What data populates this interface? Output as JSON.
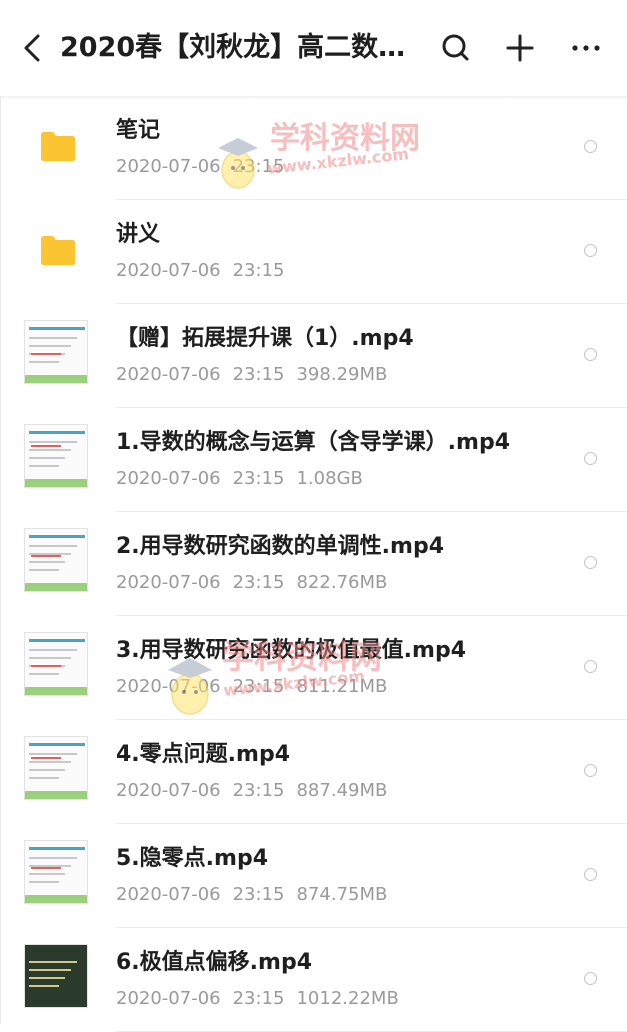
{
  "header": {
    "back_icon": "chevron-left-icon",
    "title": "2020春【刘秋龙】高二数学...",
    "search_icon": "search-icon",
    "add_icon": "plus-icon",
    "more_icon": "more-horizontal-icon"
  },
  "watermark": {
    "text_main": "学科资料网",
    "text_url": "www.xkzlw.com"
  },
  "colors": {
    "folder": "#fbc531",
    "title": "#1f1f1f",
    "meta": "#9a9a9a",
    "watermark": "#f06a6a"
  },
  "files": [
    {
      "type": "folder",
      "name": "笔记",
      "date": "2020-07-06",
      "time": "23:15",
      "size": ""
    },
    {
      "type": "folder",
      "name": "讲义",
      "date": "2020-07-06",
      "time": "23:15",
      "size": ""
    },
    {
      "type": "video",
      "name": "【赠】拓展提升课（1）.mp4",
      "date": "2020-07-06",
      "time": "23:15",
      "size": "398.29MB"
    },
    {
      "type": "video",
      "name": "1.导数的概念与运算（含导学课）.mp4",
      "date": "2020-07-06",
      "time": "23:15",
      "size": "1.08GB"
    },
    {
      "type": "video",
      "name": "2.用导数研究函数的单调性.mp4",
      "date": "2020-07-06",
      "time": "23:15",
      "size": "822.76MB"
    },
    {
      "type": "video",
      "name": "3.用导数研究函数的极值最值.mp4",
      "date": "2020-07-06",
      "time": "23:15",
      "size": "811.21MB"
    },
    {
      "type": "video",
      "name": "4.零点问题.mp4",
      "date": "2020-07-06",
      "time": "23:15",
      "size": "887.49MB"
    },
    {
      "type": "video",
      "name": "5.隐零点.mp4",
      "date": "2020-07-06",
      "time": "23:15",
      "size": "874.75MB"
    },
    {
      "type": "video-dark",
      "name": "6.极值点偏移.mp4",
      "date": "2020-07-06",
      "time": "23:15",
      "size": "1012.22MB"
    }
  ]
}
